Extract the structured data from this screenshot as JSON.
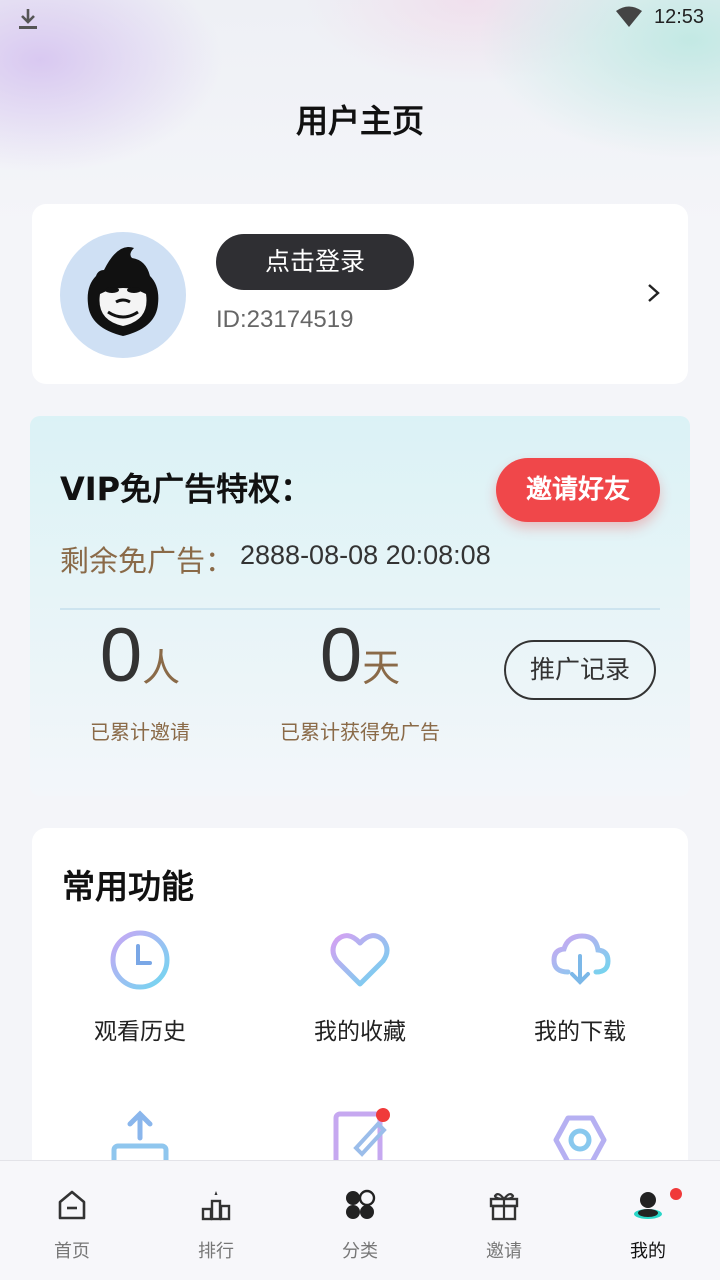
{
  "status_bar": {
    "time": "12:53"
  },
  "header": {
    "title": "用户主页"
  },
  "profile": {
    "login_label": "点击登录",
    "user_id": "ID:23174519"
  },
  "vip": {
    "title": "VIP免广告特权：",
    "invite_label": "邀请好友",
    "remaining_label": "剩余免广告：",
    "remaining_value": "2888-08-08 20:08:08",
    "invited_count": "0",
    "invited_unit": "人",
    "invited_label": "已累计邀请",
    "days_count": "0",
    "days_unit": "天",
    "days_label": "已累计获得免广告",
    "records_label": "推广记录"
  },
  "functions": {
    "title": "常用功能",
    "items": [
      {
        "label": "观看历史",
        "icon": "clock-icon"
      },
      {
        "label": "我的收藏",
        "icon": "heart-icon"
      },
      {
        "label": "我的下载",
        "icon": "cloud-download-icon"
      },
      {
        "label": "",
        "icon": "upload-icon"
      },
      {
        "label": "",
        "icon": "edit-icon"
      },
      {
        "label": "",
        "icon": "settings-icon"
      }
    ]
  },
  "nav": {
    "items": [
      {
        "label": "首页",
        "icon": "home-icon"
      },
      {
        "label": "排行",
        "icon": "ranking-icon"
      },
      {
        "label": "分类",
        "icon": "category-icon"
      },
      {
        "label": "邀请",
        "icon": "gift-icon"
      },
      {
        "label": "我的",
        "icon": "profile-icon",
        "active": true
      }
    ]
  },
  "colors": {
    "accent_red": "#f0474a",
    "gold_text": "#8a6a48",
    "dark_button": "#2f2f33"
  }
}
